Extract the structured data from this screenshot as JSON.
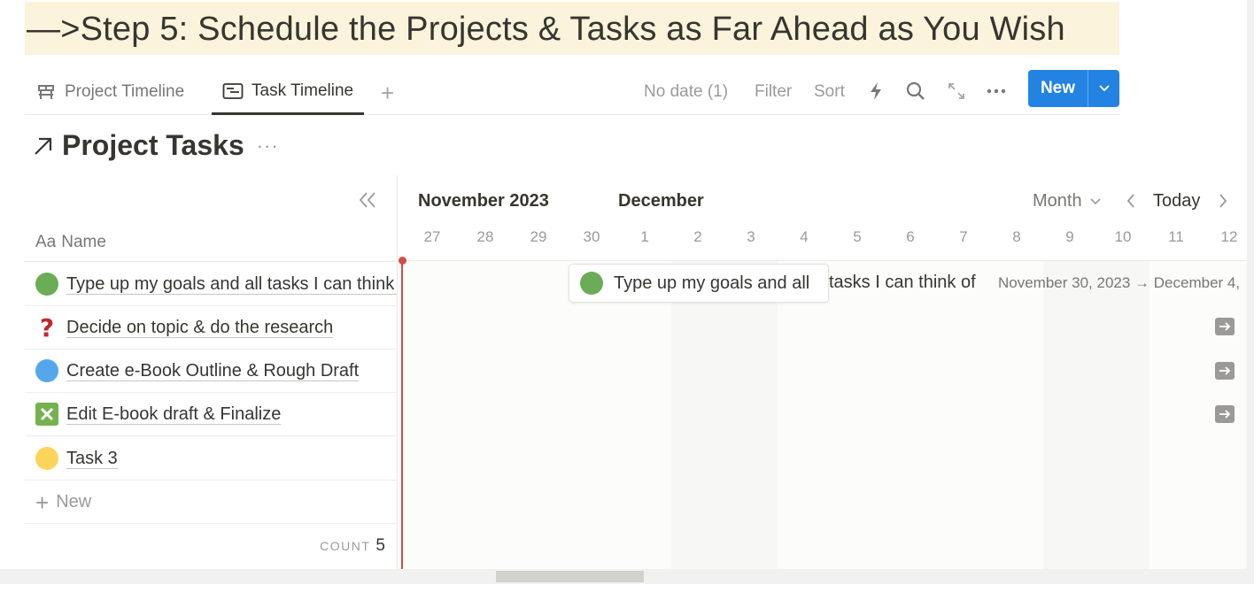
{
  "heading": {
    "text": "—>Step 5: Schedule the Projects & Tasks as Far Ahead as You Wish",
    "background": "#fbf3db"
  },
  "tabs": [
    {
      "label": "Project Timeline",
      "icon": "timeline-icon",
      "active": false
    },
    {
      "label": "Task Timeline",
      "icon": "list-timeline-icon",
      "active": true
    }
  ],
  "add_view_label": "+",
  "toolbar": {
    "no_date": "No date (1)",
    "filter": "Filter",
    "sort": "Sort",
    "icons": [
      "lightning-icon",
      "search-icon",
      "expand-icon",
      "more-icon"
    ],
    "new_label": "New",
    "accent": "#2383e2"
  },
  "database": {
    "title": "Project Tasks",
    "more": "···"
  },
  "table": {
    "name_header_prefix": "Aa",
    "name_header": "Name",
    "rows": [
      {
        "name": "Type up my goals and all tasks I can think of",
        "icon": "green-circle-icon",
        "color": "#6aad56"
      },
      {
        "name": "Decide on topic & do the research",
        "icon": "question-mark-icon",
        "color": "#c0282d"
      },
      {
        "name": "Create e-Book Outline & Rough Draft",
        "icon": "blue-circle-icon",
        "color": "#55a7ec"
      },
      {
        "name": "Edit E-book draft & Finalize",
        "icon": "cross-box-icon",
        "color": "#75b24f"
      },
      {
        "name": "Task 3",
        "icon": "yellow-circle-icon",
        "color": "#fcd45a"
      }
    ],
    "new_row": "New",
    "count_label": "COUNT",
    "count_value": "5"
  },
  "timeline": {
    "months": [
      "November 2023",
      "December"
    ],
    "zoom": "Month",
    "today": "Today",
    "days": [
      "27",
      "28",
      "29",
      "30",
      "1",
      "2",
      "3",
      "4",
      "5",
      "6",
      "7",
      "8",
      "9",
      "10",
      "11",
      "12"
    ],
    "card_title": "Type up my goals and all",
    "card_title_rest": "tasks I can think of",
    "card_dates": "November 30, 2023 → December 4,",
    "today_color": "#d44c47"
  }
}
